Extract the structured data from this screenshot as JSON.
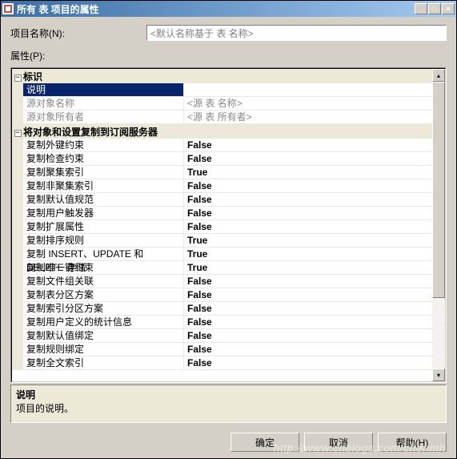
{
  "window": {
    "title": "所有 表 项目的属性"
  },
  "header": {
    "name_label": "项目名称(N):",
    "name_value": "<默认名称基于 表 名称>",
    "props_label": "属性(P):"
  },
  "categories": [
    {
      "label": "标识",
      "rows": [
        {
          "name": "说明",
          "value": "",
          "selected": true
        },
        {
          "name": "源对象名称",
          "value": "<源 表 名称>",
          "disabled": true
        },
        {
          "name": "源对象所有者",
          "value": "<源 表 所有者>",
          "disabled": true
        }
      ]
    },
    {
      "label": "将对象和设置复制到订阅服务器",
      "rows": [
        {
          "name": "复制外键约束",
          "value": "False"
        },
        {
          "name": "复制检查约束",
          "value": "False"
        },
        {
          "name": "复制聚集索引",
          "value": "True"
        },
        {
          "name": "复制非聚集索引",
          "value": "False"
        },
        {
          "name": "复制默认值规范",
          "value": "False"
        },
        {
          "name": "复制用户触发器",
          "value": "False"
        },
        {
          "name": "复制扩展属性",
          "value": "False"
        },
        {
          "name": "复制排序规则",
          "value": "True"
        },
        {
          "name": "复制 INSERT、UPDATE 和 DELETE 存储",
          "value": "True"
        },
        {
          "name": "复制唯一键约束",
          "value": "True"
        },
        {
          "name": "复制文件组关联",
          "value": "False"
        },
        {
          "name": "复制表分区方案",
          "value": "False"
        },
        {
          "name": "复制索引分区方案",
          "value": "False"
        },
        {
          "name": "复制用户定义的统计信息",
          "value": "False"
        },
        {
          "name": "复制默认值绑定",
          "value": "False"
        },
        {
          "name": "复制规则绑定",
          "value": "False"
        },
        {
          "name": "复制全文索引",
          "value": "False"
        }
      ]
    }
  ],
  "desc": {
    "title": "说明",
    "text": "项目的说明。"
  },
  "buttons": {
    "ok": "确定",
    "cancel": "取消",
    "help": "帮助(H)"
  },
  "watermark": "http://www.cnblogs.com/chenmh"
}
